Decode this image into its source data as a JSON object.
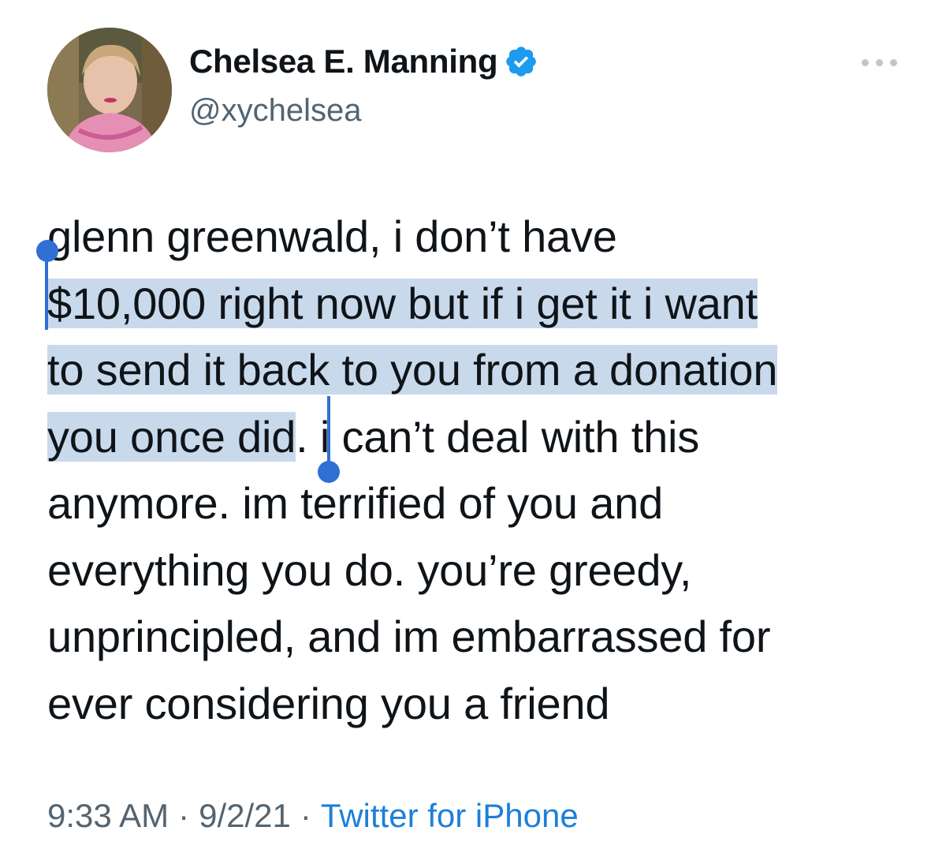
{
  "user": {
    "display_name": "Chelsea E. Manning",
    "handle": "@xychelsea",
    "verified": true,
    "avatar": "profile-photo"
  },
  "tweet": {
    "lines": [
      "glenn greenwald, i don’t have",
      "$10,000 right now but if i get it i want",
      "to send it back to you from a donation",
      "you once did",
      ". i can’t deal with this",
      "anymore. im terrified of you and",
      "everything you do. you’re greedy,",
      "unprincipled, and im embarrassed for",
      "ever considering you a friend"
    ],
    "selection_color": "#c9d9ec",
    "handle_color": "#2f6fd6"
  },
  "meta": {
    "time": "9:33 AM",
    "separator": "·",
    "date": "9/2/21",
    "source": "Twitter for iPhone",
    "source_color": "#1d7fd9"
  },
  "icons": {
    "more": "more-dots-icon",
    "verified": "verified-badge-icon"
  }
}
